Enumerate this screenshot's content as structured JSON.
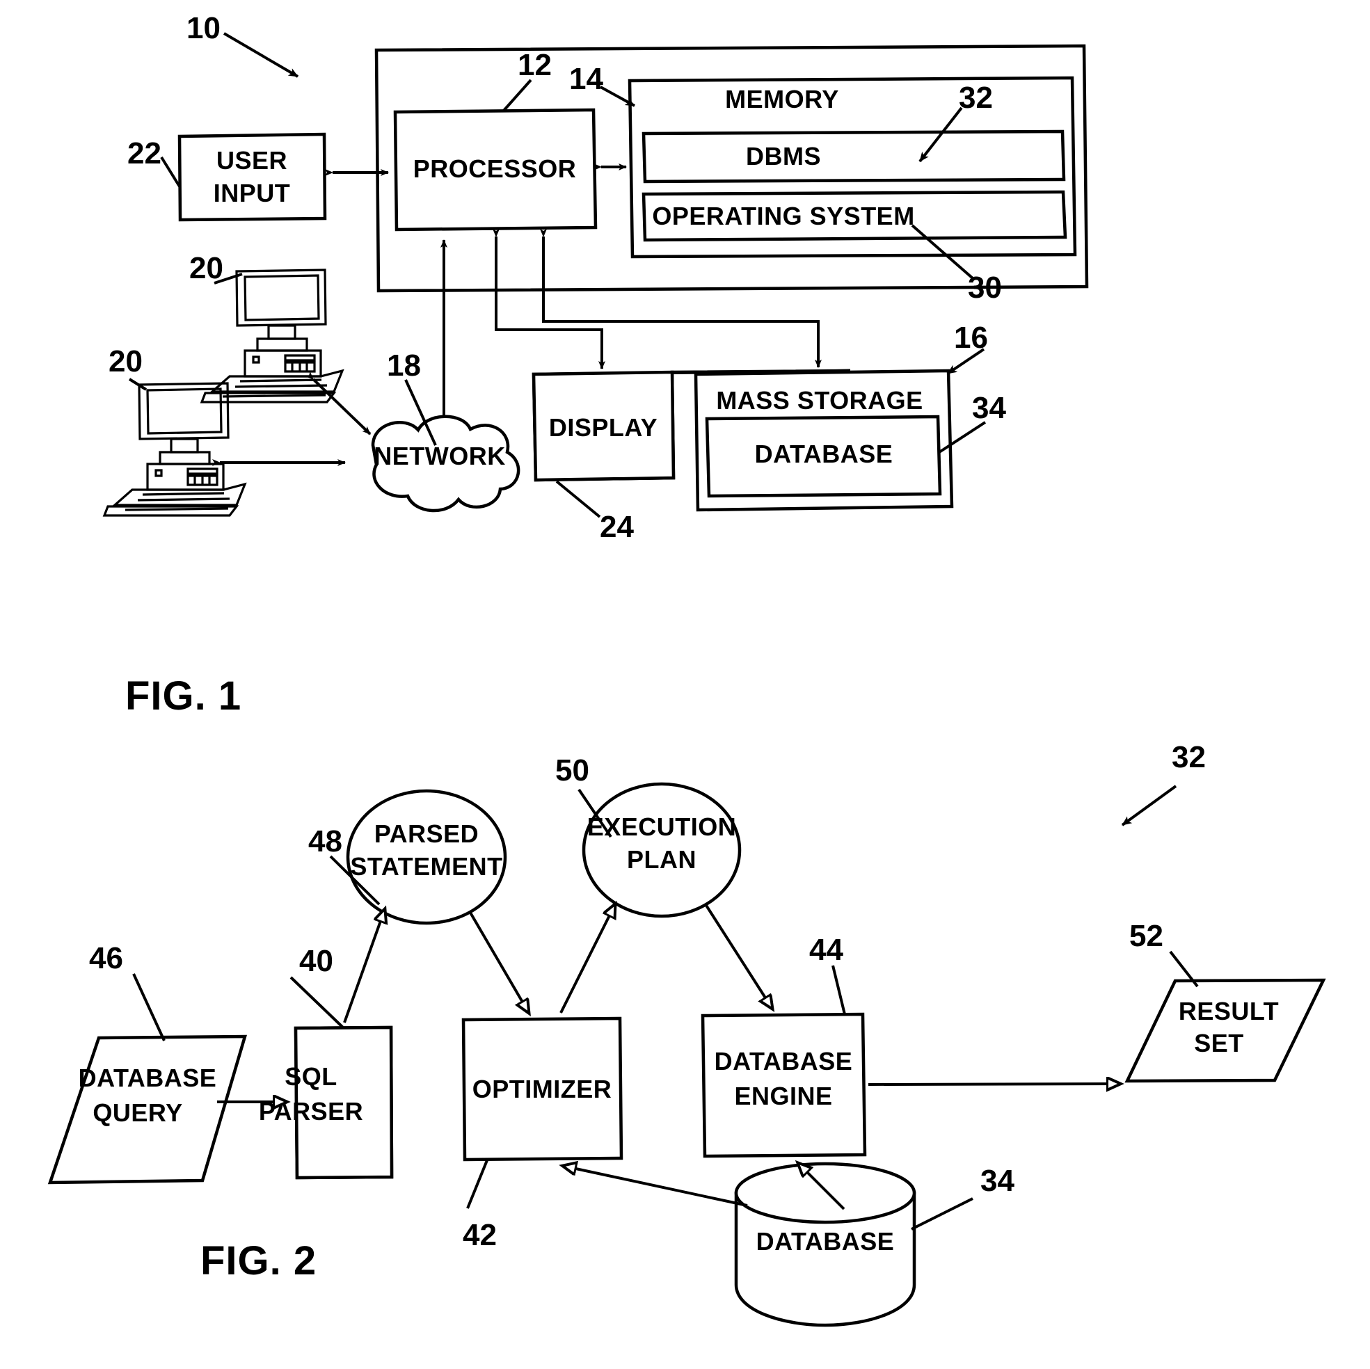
{
  "document": {
    "type": "patent-drawing-sheet",
    "figures": [
      {
        "id": "fig1",
        "label": "FIG. 1",
        "overall_ref": "10",
        "nodes": [
          {
            "key": "user_input",
            "label_line1": "USER",
            "label_line2": "INPUT",
            "ref": "22",
            "shape": "rect"
          },
          {
            "key": "processor",
            "label_line1": "PROCESSOR",
            "label_line2": "",
            "ref": "12",
            "shape": "rect"
          },
          {
            "key": "memory",
            "label_line1": "MEMORY",
            "label_line2": "",
            "ref": "14",
            "shape": "rect"
          },
          {
            "key": "dbms",
            "label_line1": "DBMS",
            "label_line2": "",
            "ref": "32",
            "shape": "rect"
          },
          {
            "key": "os",
            "label_line1": "OPERATING SYSTEM",
            "label_line2": "",
            "ref": "30",
            "shape": "rect"
          },
          {
            "key": "network",
            "label_line1": "NETWORK",
            "label_line2": "",
            "ref": "18",
            "shape": "cloud"
          },
          {
            "key": "display",
            "label_line1": "DISPLAY",
            "label_line2": "",
            "ref": "24",
            "shape": "rect"
          },
          {
            "key": "mass_storage",
            "label_line1": "MASS STORAGE",
            "label_line2": "",
            "ref": "16",
            "shape": "rect"
          },
          {
            "key": "database",
            "label_line1": "DATABASE",
            "label_line2": "",
            "ref": "34",
            "shape": "rect"
          },
          {
            "key": "client_top",
            "label_line1": "",
            "label_line2": "",
            "ref": "20",
            "shape": "computer"
          },
          {
            "key": "client_bottom",
            "label_line1": "",
            "label_line2": "",
            "ref": "20",
            "shape": "computer"
          }
        ],
        "reference_numerals": [
          "10",
          "12",
          "14",
          "16",
          "18",
          "20",
          "20",
          "22",
          "24",
          "30",
          "32",
          "34"
        ]
      },
      {
        "id": "fig2",
        "label": "FIG. 2",
        "overall_ref": "32",
        "nodes": [
          {
            "key": "database_query",
            "label_line1": "DATABASE",
            "label_line2": "QUERY",
            "ref": "46",
            "shape": "parallelogram"
          },
          {
            "key": "sql_parser",
            "label_line1": "SQL",
            "label_line2": "PARSER",
            "ref": "40",
            "shape": "rect"
          },
          {
            "key": "parsed_statement",
            "label_line1": "PARSED",
            "label_line2": "STATEMENT",
            "ref": "48",
            "shape": "ellipse"
          },
          {
            "key": "optimizer",
            "label_line1": "OPTIMIZER",
            "label_line2": "",
            "ref": "42",
            "shape": "rect"
          },
          {
            "key": "execution_plan",
            "label_line1": "EXECUTION",
            "label_line2": "PLAN",
            "ref": "50",
            "shape": "ellipse"
          },
          {
            "key": "database_engine",
            "label_line1": "DATABASE",
            "label_line2": "ENGINE",
            "ref": "44",
            "shape": "rect"
          },
          {
            "key": "result_set",
            "label_line1": "RESULT",
            "label_line2": "SET",
            "ref": "52",
            "shape": "parallelogram"
          },
          {
            "key": "database_store",
            "label_line1": "DATABASE",
            "label_line2": "",
            "ref": "34",
            "shape": "cylinder"
          }
        ],
        "reference_numerals": [
          "32",
          "34",
          "40",
          "42",
          "44",
          "46",
          "48",
          "50",
          "52"
        ]
      }
    ],
    "colors": {
      "ink": "#000000",
      "paper": "#ffffff"
    }
  }
}
